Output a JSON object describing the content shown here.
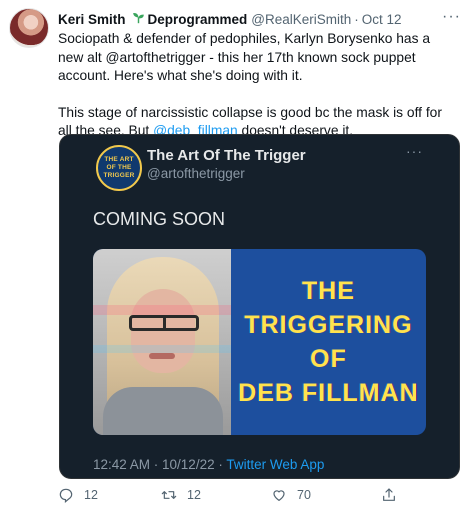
{
  "tweet": {
    "author_name": "Keri Smith",
    "badge_icon": "sprout-icon",
    "display_suffix": "Deprogrammed",
    "handle": "@RealKeriSmith",
    "separator": "·",
    "date": "Oct 12",
    "more_label": "···",
    "text_line1": "Sociopath & defender of pedophiles, Karlyn Borysenko has a new alt @artofthetrigger - this her 17th known sock puppet account. Here's what she's doing with it.",
    "text_line2_prefix": "This stage of narcissistic collapse is good bc the mask is off for all the see. But ",
    "text_line2_mention": "@deb_fillman",
    "text_line2_suffix": " doesn't deserve it."
  },
  "quote": {
    "avatar_text": [
      "THE ART",
      "OF THE",
      "TRIGGER"
    ],
    "name": "The Art Of The Trigger",
    "handle": "@artofthetrigger",
    "more_label": "···",
    "text": "COMING SOON",
    "image_title": [
      "THE",
      "TRIGGERING",
      "OF",
      "DEB FILLMAN"
    ],
    "time": "12:42 AM · 10/12/22 · ",
    "via": "Twitter Web App"
  },
  "actions": {
    "reply_count": "12",
    "retweet_count": "12",
    "like_count": "70"
  },
  "colors": {
    "link": "#1d9bf0",
    "quote_bg": "#15202b",
    "promo_bg": "#1d4f9e",
    "promo_title": "#ffe34d"
  }
}
